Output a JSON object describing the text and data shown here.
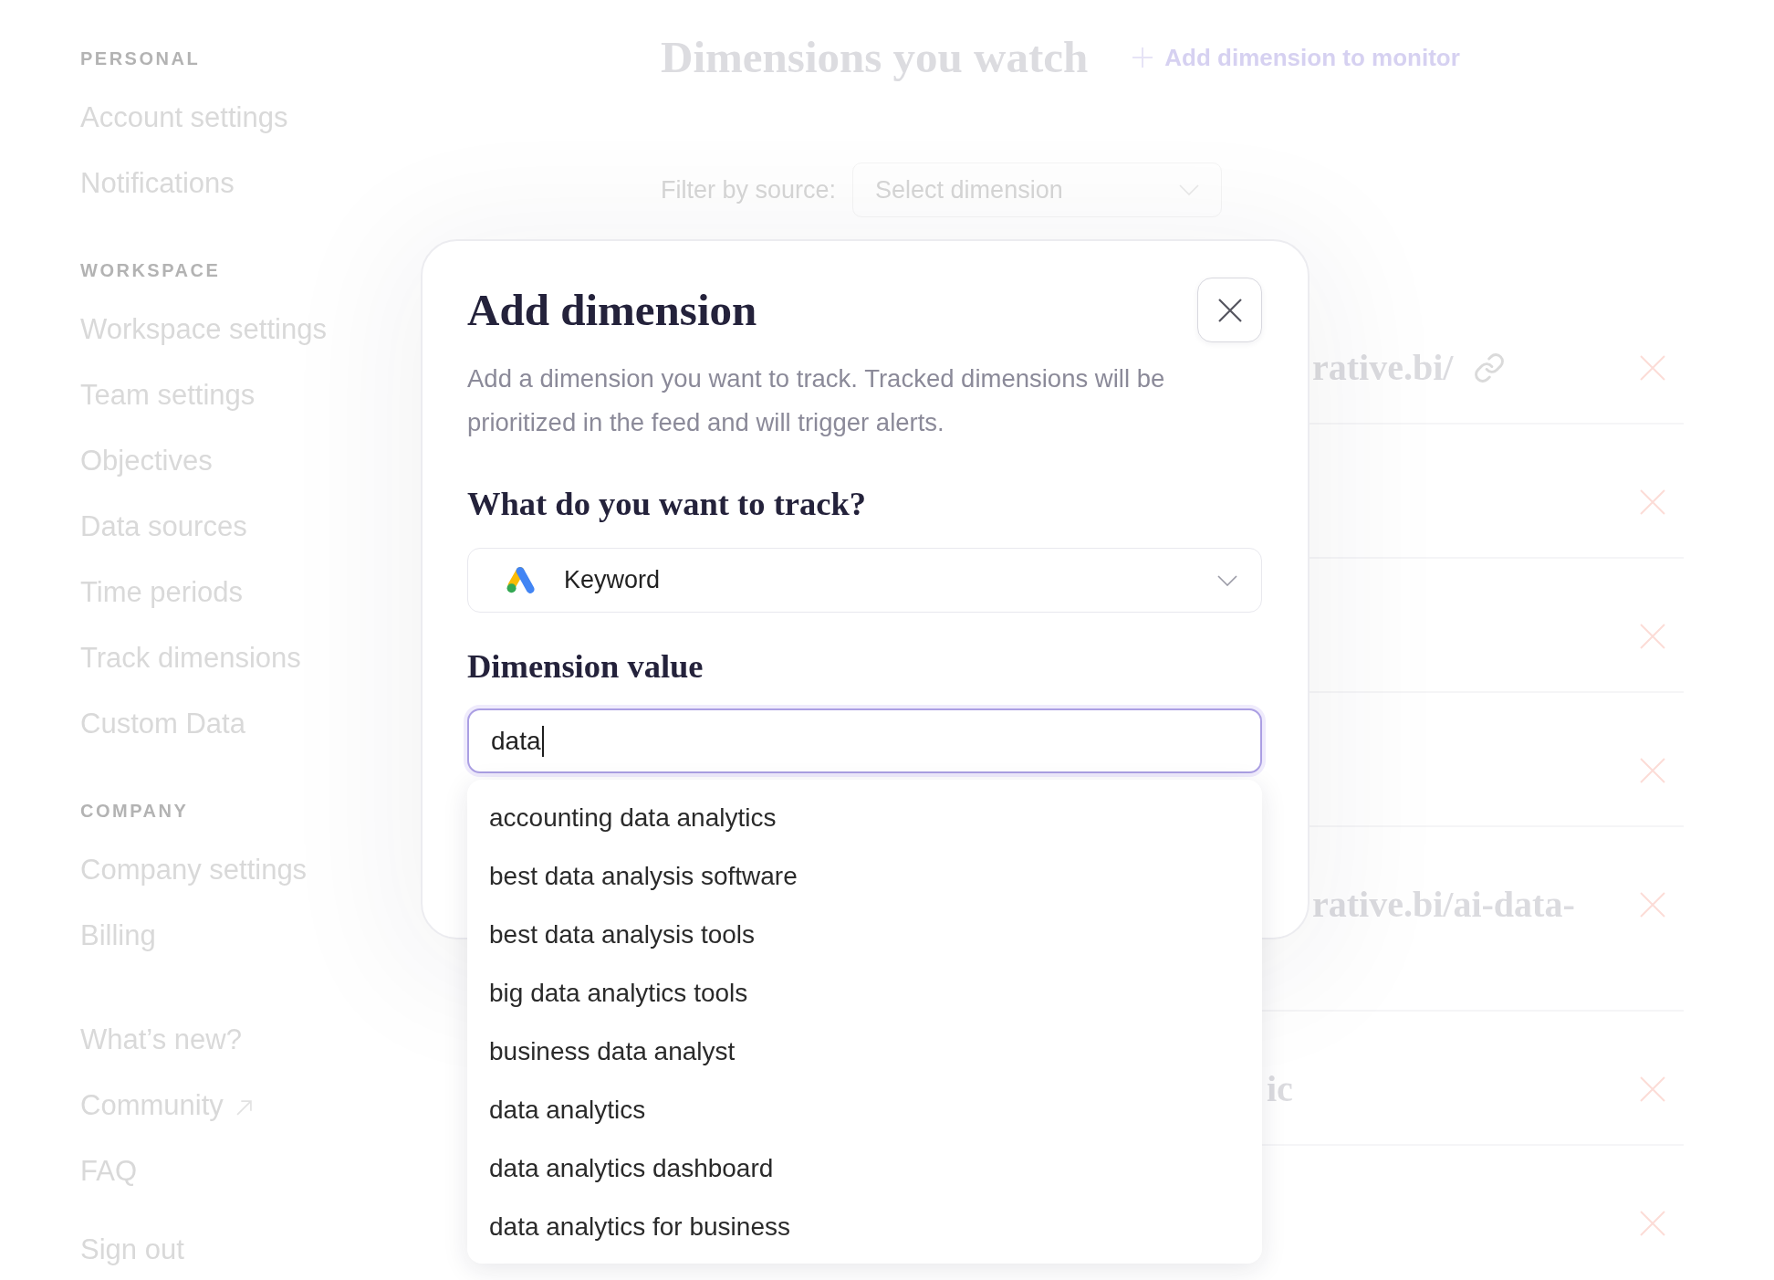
{
  "sidebar": {
    "sections": [
      {
        "label": "PERSONAL",
        "items": [
          {
            "label": "Account settings",
            "external": false
          },
          {
            "label": "Notifications",
            "external": false
          }
        ]
      },
      {
        "label": "WORKSPACE",
        "items": [
          {
            "label": "Workspace settings",
            "external": false
          },
          {
            "label": "Team settings",
            "external": false
          },
          {
            "label": "Objectives",
            "external": false
          },
          {
            "label": "Data sources",
            "external": false
          },
          {
            "label": "Time periods",
            "external": false
          },
          {
            "label": "Track dimensions",
            "external": false
          },
          {
            "label": "Custom Data",
            "external": false
          }
        ]
      },
      {
        "label": "COMPANY",
        "items": [
          {
            "label": "Company settings",
            "external": false
          },
          {
            "label": "Billing",
            "external": false
          }
        ]
      },
      {
        "items": [
          {
            "label": "What’s new?",
            "external": false
          },
          {
            "label": "Community",
            "external": true
          },
          {
            "label": "FAQ",
            "external": false
          }
        ]
      },
      {
        "items": [
          {
            "label": "Sign out",
            "external": false
          }
        ]
      }
    ]
  },
  "main": {
    "title": "Dimensions you watch",
    "add_button": "Add dimension to monitor",
    "filter": {
      "label": "Filter by source:",
      "placeholder": "Select dimension"
    },
    "rows": [
      {
        "text": "rative.bi/",
        "link": true
      },
      {
        "link": false
      },
      {
        "link": false
      },
      {
        "link": false
      },
      {
        "text": "rative.bi/ai-data-",
        "link": false
      },
      {
        "text": "ic",
        "link": false
      },
      {
        "link": false
      }
    ]
  },
  "dialog": {
    "title": "Add dimension",
    "description": "Add a dimension you want to track. Tracked dimensions will be prioritized in the feed and will trigger alerts.",
    "track_label": "What do you want to track?",
    "track_value": "Keyword",
    "value_label": "Dimension value",
    "value": "data",
    "suggestions": [
      "accounting data analytics",
      "best data analysis software",
      "best data analysis tools",
      "big data analytics tools",
      "business data analyst",
      "data analytics",
      "data analytics dashboard",
      "data analytics for business"
    ]
  }
}
